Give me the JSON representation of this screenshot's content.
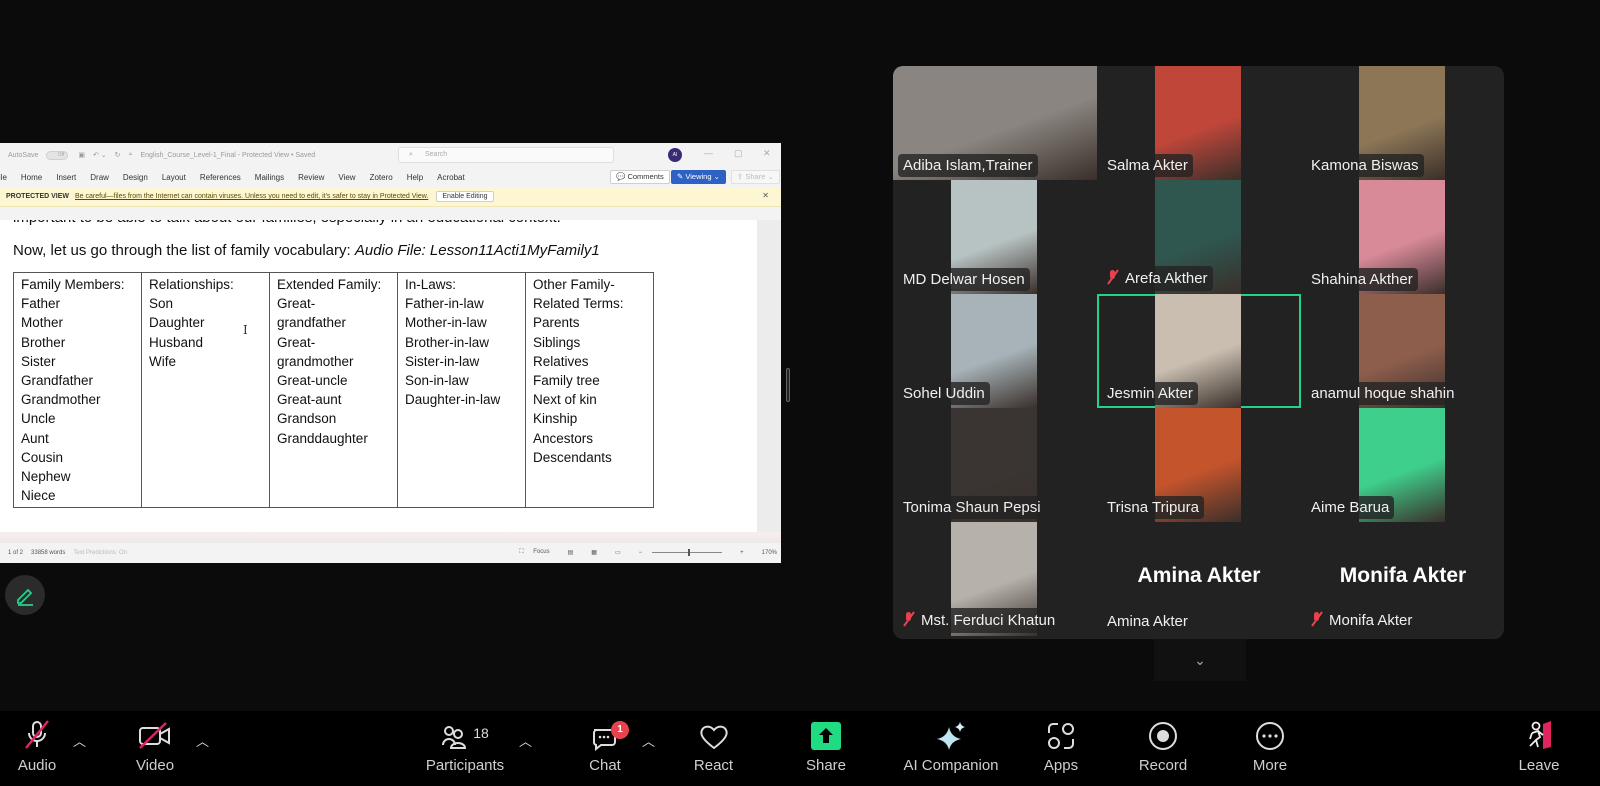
{
  "word": {
    "autosave_label": "AutoSave",
    "autosave_state": "Off",
    "doc_title": "English_Course_Level-1_Final  -  Protected View  •  Saved",
    "search_placeholder": "Search",
    "avatar_initials": "AI",
    "ribbon_tabs": [
      "File",
      "Home",
      "Insert",
      "Draw",
      "Design",
      "Layout",
      "References",
      "Mailings",
      "Review",
      "View",
      "Zotero",
      "Help",
      "Acrobat"
    ],
    "comments_label": "Comments",
    "viewing_label": "Viewing",
    "share_label": "Share",
    "protected_title": "PROTECTED VIEW",
    "protected_message": "Be careful—files from the Internet can contain viruses. Unless you need to edit, it's safer to stay in Protected View.",
    "enable_editing_label": "Enable Editing",
    "doc_line_cut": "important to be able to talk about our families, especially in an educational context.",
    "doc_line_main": "Now, let us go through the list of family vocabulary: ",
    "doc_line_audio": "Audio File: Lesson11Acti1MyFamily1",
    "table": {
      "columns": [
        [
          "Family Members:",
          "Father",
          "Mother",
          "Brother",
          "Sister",
          "Grandfather",
          "Grandmother",
          "Uncle",
          "Aunt",
          "Cousin",
          "Nephew",
          "Niece"
        ],
        [
          "Relationships:",
          "Son",
          "Daughter",
          "Husband",
          "Wife"
        ],
        [
          "Extended Family:",
          "Great-",
          "grandfather",
          "Great-",
          "grandmother",
          "Great-uncle",
          "Great-aunt",
          "Grandson",
          "Granddaughter"
        ],
        [
          "In-Laws:",
          "Father-in-law",
          "Mother-in-law",
          "Brother-in-law",
          "Sister-in-law",
          "Son-in-law",
          "Daughter-in-law"
        ],
        [
          "Other Family-",
          "Related Terms:",
          "Parents",
          "Siblings",
          "Relatives",
          "Family tree",
          "Next of kin",
          "Kinship",
          "Ancestors",
          "Descendants"
        ]
      ]
    },
    "status": {
      "page": "1 of 2",
      "words": "33858 words",
      "text_predictions": "Text Predictions: On",
      "focus_label": "Focus",
      "zoom": "170%"
    }
  },
  "gallery": {
    "participants": [
      {
        "name": "Adiba Islam,Trainer",
        "muted": false,
        "video": true,
        "bg": "#8a8580"
      },
      {
        "name": "Salma Akter",
        "muted": false,
        "video": true,
        "bg": "#c0463a"
      },
      {
        "name": "Kamona Biswas",
        "muted": false,
        "video": true,
        "bg": "#8c7656"
      },
      {
        "name": "MD Delwar Hosen",
        "muted": false,
        "video": true,
        "bg": "#b7c2c2"
      },
      {
        "name": "Arefa Akther",
        "muted": true,
        "video": true,
        "bg": "#2f5750"
      },
      {
        "name": "Shahina Akther",
        "muted": false,
        "video": true,
        "bg": "#d98a99"
      },
      {
        "name": "Sohel Uddin",
        "muted": false,
        "video": true,
        "bg": "#a7b3b8"
      },
      {
        "name": "Jesmin Akter",
        "muted": false,
        "video": true,
        "bg": "#c9beb0",
        "active_speaker": true
      },
      {
        "name": "anamul hoque shahin",
        "muted": false,
        "video": true,
        "bg": "#8e5e4c"
      },
      {
        "name": "Tonima Shaun Pepsi",
        "muted": false,
        "video": true,
        "bg": "#3a3533"
      },
      {
        "name": "Trisna Tripura",
        "muted": false,
        "video": true,
        "bg": "#c4542c"
      },
      {
        "name": "Aime Barua",
        "muted": false,
        "video": true,
        "bg": "#3fcf8c"
      },
      {
        "name": "Mst. Ferduci Khatun",
        "muted": true,
        "video": true,
        "bg": "#b6b1aa"
      },
      {
        "name": "Amina Akter",
        "muted": false,
        "video": false,
        "display": "Amina Akter"
      },
      {
        "name": "Monifa Akter",
        "muted": true,
        "video": false,
        "display": "Monifa Akter"
      }
    ]
  },
  "toolbar": {
    "audio": "Audio",
    "video": "Video",
    "participants": "Participants",
    "participant_count": "18",
    "chat": "Chat",
    "chat_badge": "1",
    "react": "React",
    "share": "Share",
    "ai_companion": "AI Companion",
    "apps": "Apps",
    "record": "Record",
    "more": "More",
    "leave": "Leave"
  },
  "colors": {
    "share_green": "#1fdc83",
    "active_speaker": "#23d18b",
    "muted_red": "#e8424e",
    "word_blue": "#2d62c4",
    "protected_yellow": "#fdf6d2"
  }
}
